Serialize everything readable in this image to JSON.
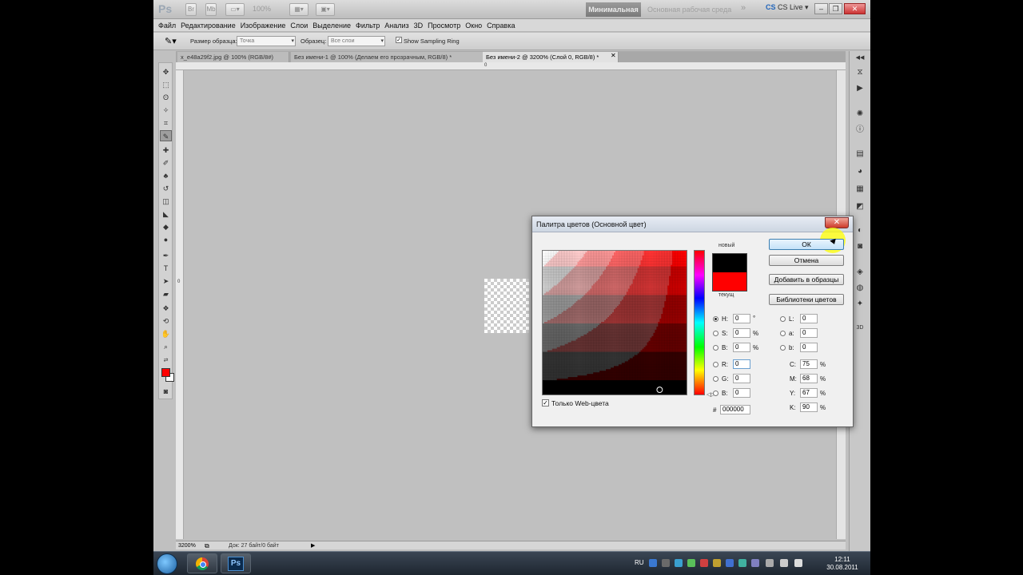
{
  "appbar": {
    "logo": "Ps",
    "zoom": "100%",
    "workspace_active": "Минимальная",
    "workspace_inactive": "Основная рабочая среда",
    "cslive": "CS Live"
  },
  "menu": [
    "Файл",
    "Редактирование",
    "Изображение",
    "Слои",
    "Выделение",
    "Фильтр",
    "Анализ",
    "3D",
    "Просмотр",
    "Окно",
    "Справка"
  ],
  "options": {
    "sample_size_label": "Размер образца:",
    "sample_size_value": "Точка",
    "sample_label": "Образец:",
    "sample_value": "Все слои",
    "sampling_ring_label": "Show Sampling Ring",
    "sampling_ring_checked": true
  },
  "tabs": [
    {
      "label": "x_e48a29f2.jpg @ 100% (RGB/8#)"
    },
    {
      "label": "Без имени-1 @ 100% (Делаем его прозрачным, RGB/8) *"
    },
    {
      "label": "Без имени-2 @ 3200% (Слой 0, RGB/8) *"
    }
  ],
  "status": {
    "zoom": "3200%",
    "doc": "Док: 27 байт/0 байт"
  },
  "colors": {
    "foreground": "#ff0000",
    "background": "#ffffff",
    "new_color": "#000000",
    "current_color": "#ff0000"
  },
  "dialog": {
    "title": "Палитра цветов (Основной цвет)",
    "close": "✕",
    "new_label": "новый",
    "current_label": "текущ",
    "buttons": {
      "ok": "ОК",
      "cancel": "Отмена",
      "add_swatch": "Добавить в образцы",
      "libraries": "Библиотеки цветов"
    },
    "hsb": {
      "h": "0",
      "h_unit": "°",
      "s": "0",
      "s_unit": "%",
      "b": "0",
      "b_unit": "%"
    },
    "rgb": {
      "r": "0",
      "g": "0",
      "b": "0"
    },
    "lab": {
      "l": "0",
      "a": "0",
      "b": "0"
    },
    "cmyk": {
      "c": "75",
      "m": "68",
      "y": "67",
      "k": "90",
      "unit": "%"
    },
    "hex": "000000",
    "web_only_label": "Только Web-цвета",
    "web_only_checked": true,
    "labels": {
      "h": "H:",
      "s": "S:",
      "bh": "B:",
      "r": "R:",
      "g": "G:",
      "bb": "B:",
      "l": "L:",
      "a": "a:",
      "lab_b": "b:",
      "c": "C:",
      "m": "M:",
      "y": "Y:",
      "k": "K:",
      "hash": "#"
    }
  },
  "taskbar": {
    "ps_label": "Ps",
    "lang": "RU",
    "time": "12:11",
    "date": "30.08.2011"
  }
}
